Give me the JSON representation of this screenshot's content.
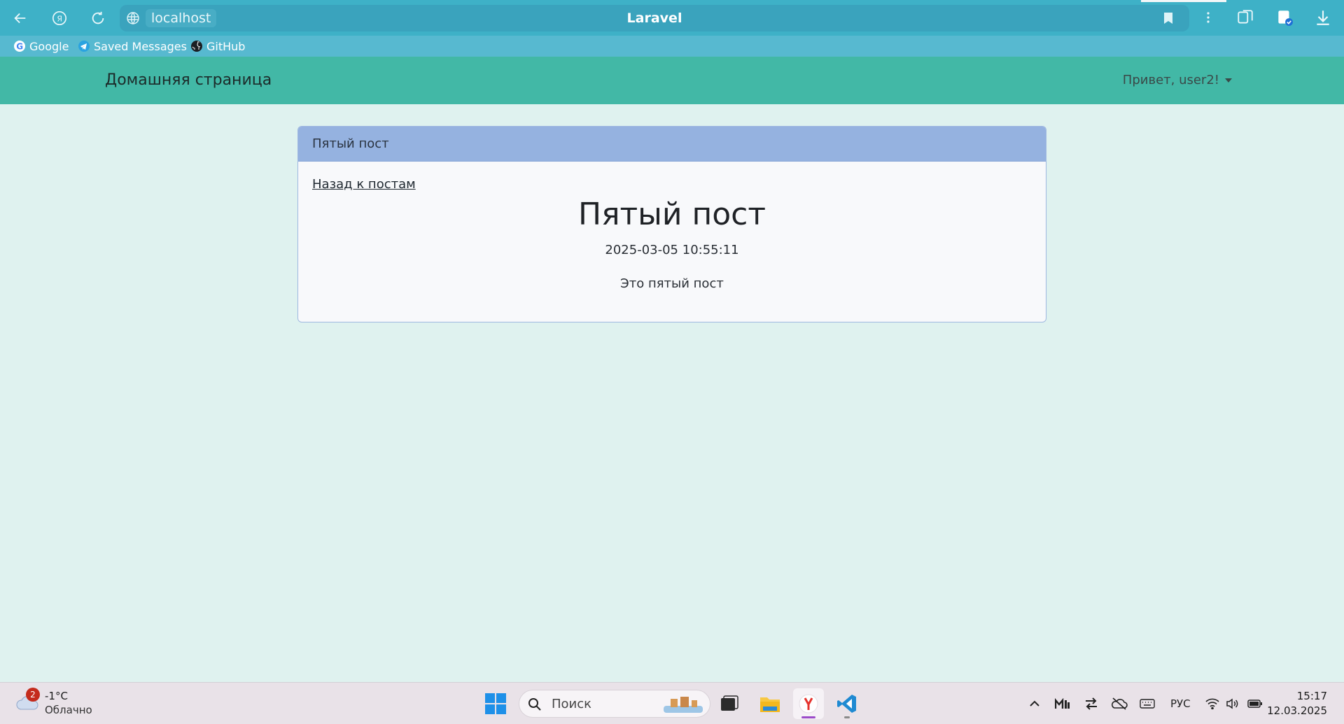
{
  "browser": {
    "host": "localhost",
    "tab_title": "Laravel",
    "bookmarks": [
      {
        "label": "Google",
        "icon": "google-icon"
      },
      {
        "label": "Saved Messages",
        "icon": "telegram-icon"
      },
      {
        "label": "GitHub",
        "icon": "github-icon"
      }
    ]
  },
  "site": {
    "brand": "Домашняя страница",
    "user_menu": "Привет, user2!"
  },
  "card": {
    "header": "Пятый пост",
    "back_link": "Назад к постам",
    "title": "Пятый пост",
    "date": "2025-03-05 10:55:11",
    "body": "Это пятый пост"
  },
  "taskbar": {
    "weather_badge": "2",
    "temperature": "-1°C",
    "condition": "Облачно",
    "search_placeholder": "Поиск",
    "language": "РУС",
    "time": "15:17",
    "date": "12.03.2025"
  },
  "colors": {
    "browser_chrome": "#3eb1c7",
    "navbar": "#42b8a6",
    "card_header": "#95b2e0",
    "page_bg": "#dff2ef"
  }
}
